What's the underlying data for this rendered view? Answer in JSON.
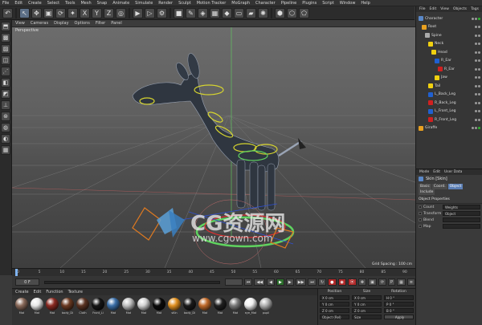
{
  "menubar": [
    "File",
    "Edit",
    "Create",
    "Select",
    "Tools",
    "Mesh",
    "Snap",
    "Animate",
    "Simulate",
    "Render",
    "Sculpt",
    "Motion Tracker",
    "MoGraph",
    "Character",
    "Pipeline",
    "Plugins",
    "Script",
    "Window",
    "Help"
  ],
  "viewport": {
    "menu": [
      "View",
      "Cameras",
      "Display",
      "Options",
      "Filter",
      "Panel"
    ],
    "label": "Perspective",
    "grid_spacing": "Grid Spacing : 100 cm",
    "watermark_main": "CG资源网",
    "watermark_url": "www.cgown.com"
  },
  "timeline": {
    "ticks": [
      "0",
      "5",
      "10",
      "15",
      "20",
      "25",
      "30",
      "35",
      "40",
      "45",
      "50",
      "55",
      "60",
      "65",
      "70",
      "75",
      "80",
      "85",
      "90"
    ],
    "frame_start": "0 F",
    "frame_end": "90 F",
    "current": "0 F"
  },
  "materials": {
    "menu": [
      "Create",
      "Edit",
      "Function",
      "Texture"
    ],
    "items": [
      {
        "label": "Mat",
        "color": "#8a6a5a"
      },
      {
        "label": "Mat",
        "color": "#e8e8e8"
      },
      {
        "label": "Mat",
        "color": "#8a2a22"
      },
      {
        "label": "body_Di",
        "color": "#6b3a22"
      },
      {
        "label": "Cloth",
        "color": "#5a3322"
      },
      {
        "label": "Front_Li",
        "color": "#151515"
      },
      {
        "label": "Mat",
        "color": "#3b6fa8"
      },
      {
        "label": "Mat",
        "color": "#c0c0c0"
      },
      {
        "label": "Mat",
        "color": "#d2d2d2"
      },
      {
        "label": "Mat",
        "color": "#0a0a0a"
      },
      {
        "label": "sKin",
        "color": "#e09020"
      },
      {
        "label": "body_Di",
        "color": "#1a1a1a"
      },
      {
        "label": "Mat",
        "color": "#c06a2a"
      },
      {
        "label": "Mat",
        "color": "#202020"
      },
      {
        "label": "Mat",
        "color": "#7a7a7a"
      },
      {
        "label": "eye_Mat",
        "color": "#f0f0f0"
      },
      {
        "label": "pupil",
        "color": "#b0b0b0"
      }
    ]
  },
  "coords": {
    "headers": [
      "Position",
      "Size",
      "Rotation"
    ],
    "rows": [
      [
        "X  0 cm",
        "X  0 cm",
        "H  0 °"
      ],
      [
        "Y  0 cm",
        "Y  0 cm",
        "P  0 °"
      ],
      [
        "Z  0 cm",
        "Z  0 cm",
        "B  0 °"
      ]
    ],
    "mode": "Object (Rel)",
    "size_mode": "Size",
    "apply": "Apply"
  },
  "objects": {
    "menu": [
      "File",
      "Edit",
      "View",
      "Objects",
      "Tags"
    ],
    "items": [
      {
        "label": "Character",
        "color": "#5a88c8",
        "indent": 0
      },
      {
        "label": "Root",
        "color": "#e8a020",
        "indent": 1
      },
      {
        "label": "Spine",
        "color": "#aaaaaa",
        "indent": 2
      },
      {
        "label": "Neck",
        "color": "#f0d010",
        "indent": 3
      },
      {
        "label": "Head",
        "color": "#f0d010",
        "indent": 4
      },
      {
        "label": "R_Ear",
        "color": "#2060d0",
        "indent": 5
      },
      {
        "label": "R_Ear",
        "color": "#d02020",
        "indent": 6
      },
      {
        "label": "Jaw",
        "color": "#f0d010",
        "indent": 5
      },
      {
        "label": "Tail",
        "color": "#f0d010",
        "indent": 3
      },
      {
        "label": "L_Back_Leg",
        "color": "#2060d0",
        "indent": 3
      },
      {
        "label": "R_Back_Leg",
        "color": "#d02020",
        "indent": 3
      },
      {
        "label": "L_Front_Leg",
        "color": "#2060d0",
        "indent": 3
      },
      {
        "label": "R_Front_Leg",
        "color": "#d02020",
        "indent": 3
      },
      {
        "label": "Giraffe",
        "color": "#e8a020",
        "indent": 0
      }
    ]
  },
  "attributes": {
    "menu": [
      "Mode",
      "Edit",
      "User Data"
    ],
    "title": "Skin [Skin]",
    "tabs": [
      "Basic",
      "Coord.",
      "Object",
      "Include"
    ],
    "active_tab": "Object",
    "section": "Object Properties",
    "rows": [
      {
        "label": "Count",
        "value": "Weights"
      },
      {
        "label": "Transform",
        "value": "Object"
      },
      {
        "label": "Blend",
        "value": ""
      },
      {
        "label": "Map",
        "value": ""
      }
    ]
  }
}
